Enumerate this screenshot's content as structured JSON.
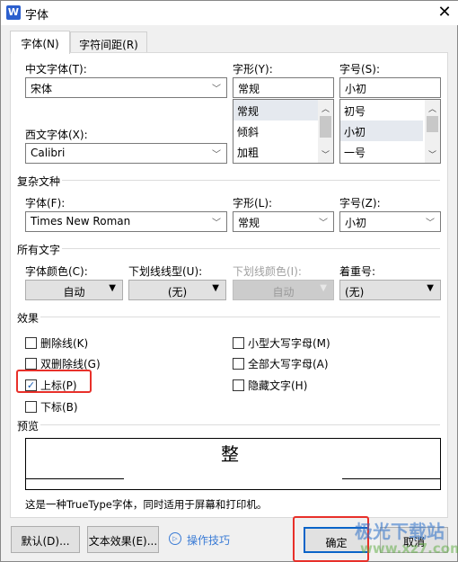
{
  "window": {
    "title": "字体",
    "app_icon": "W",
    "close_icon": "close-icon"
  },
  "tabs": [
    {
      "label": "字体(N)",
      "active": true
    },
    {
      "label": "字符间距(R)",
      "active": false
    }
  ],
  "latin": {
    "chinese_font_label": "中文字体(T):",
    "chinese_font_value": "宋体",
    "style_label": "字形(Y):",
    "style_value": "常规",
    "style_options": [
      "常规",
      "倾斜",
      "加粗"
    ],
    "style_selected": "常规",
    "size_label": "字号(S):",
    "size_value": "小初",
    "size_options": [
      "初号",
      "小初",
      "一号"
    ],
    "size_selected": "小初",
    "western_font_label": "西文字体(X):",
    "western_font_value": "Calibri"
  },
  "complex": {
    "group": "复杂文种",
    "font_label": "字体(F):",
    "font_value": "Times New Roman",
    "style_label": "字形(L):",
    "style_value": "常规",
    "size_label": "字号(Z):",
    "size_value": "小初"
  },
  "all_text": {
    "group": "所有文字",
    "color_label": "字体颜色(C):",
    "color_value": "自动",
    "underline_label": "下划线线型(U):",
    "underline_value": "(无)",
    "underline_color_label": "下划线颜色(I):",
    "underline_color_value": "自动",
    "emphasis_label": "着重号:",
    "emphasis_value": "(无)"
  },
  "effects": {
    "group": "效果",
    "items": [
      {
        "label": "删除线(K)",
        "checked": false
      },
      {
        "label": "双删除线(G)",
        "checked": false
      },
      {
        "label": "上标(P)",
        "checked": true
      },
      {
        "label": "下标(B)",
        "checked": false
      },
      {
        "label": "小型大写字母(M)",
        "checked": false
      },
      {
        "label": "全部大写字母(A)",
        "checked": false
      },
      {
        "label": "隐藏文字(H)",
        "checked": false
      }
    ]
  },
  "preview": {
    "group": "预览",
    "sample": "整",
    "description": "这是一种TrueType字体，同时适用于屏幕和打印机。"
  },
  "footer": {
    "default_label": "默认(D)...",
    "text_effects_label": "文本效果(E)...",
    "tips_label": "操作技巧",
    "ok_label": "确定",
    "cancel_label": "取消"
  },
  "watermark": {
    "text": "极光下载站",
    "url": "www.xz7.com"
  },
  "colors": {
    "highlight": "#e8302a",
    "link": "#3a7bd5",
    "ok_border": "#0a64c8"
  }
}
